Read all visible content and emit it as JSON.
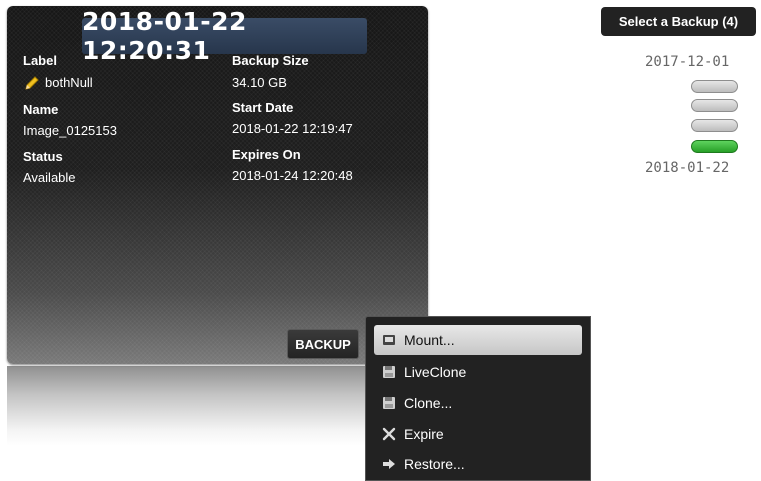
{
  "backup": {
    "date_title": "2018-01-22 12:20:31",
    "label_heading": "Label",
    "label_value": "bothNull",
    "name_heading": "Name",
    "name_value": "Image_0125153",
    "status_heading": "Status",
    "status_value": "Available",
    "size_heading": "Backup Size",
    "size_value": "34.10 GB",
    "start_heading": "Start Date",
    "start_value": "2018-01-22 12:19:47",
    "expires_heading": "Expires On",
    "expires_value": "2018-01-24 12:20:48",
    "backup_button": "BACKUP"
  },
  "menu": {
    "items": [
      {
        "label": "Mount...",
        "icon": "disk-icon",
        "highlighted": true
      },
      {
        "label": "LiveClone",
        "icon": "floppy-icon",
        "highlighted": false
      },
      {
        "label": "Clone...",
        "icon": "floppy-icon",
        "highlighted": false
      },
      {
        "label": "Expire",
        "icon": "x-icon",
        "highlighted": false
      },
      {
        "label": "Restore...",
        "icon": "arrow-right-icon",
        "highlighted": false
      }
    ]
  },
  "selector": {
    "title": "Select a Backup (4)",
    "start_date": "2017-12-01",
    "end_date": "2018-01-22",
    "slots": [
      {
        "selected": false
      },
      {
        "selected": false
      },
      {
        "selected": false
      },
      {
        "selected": true
      }
    ],
    "colors": {
      "selected": "#2fae2f",
      "unselected": "#cccccc"
    }
  }
}
